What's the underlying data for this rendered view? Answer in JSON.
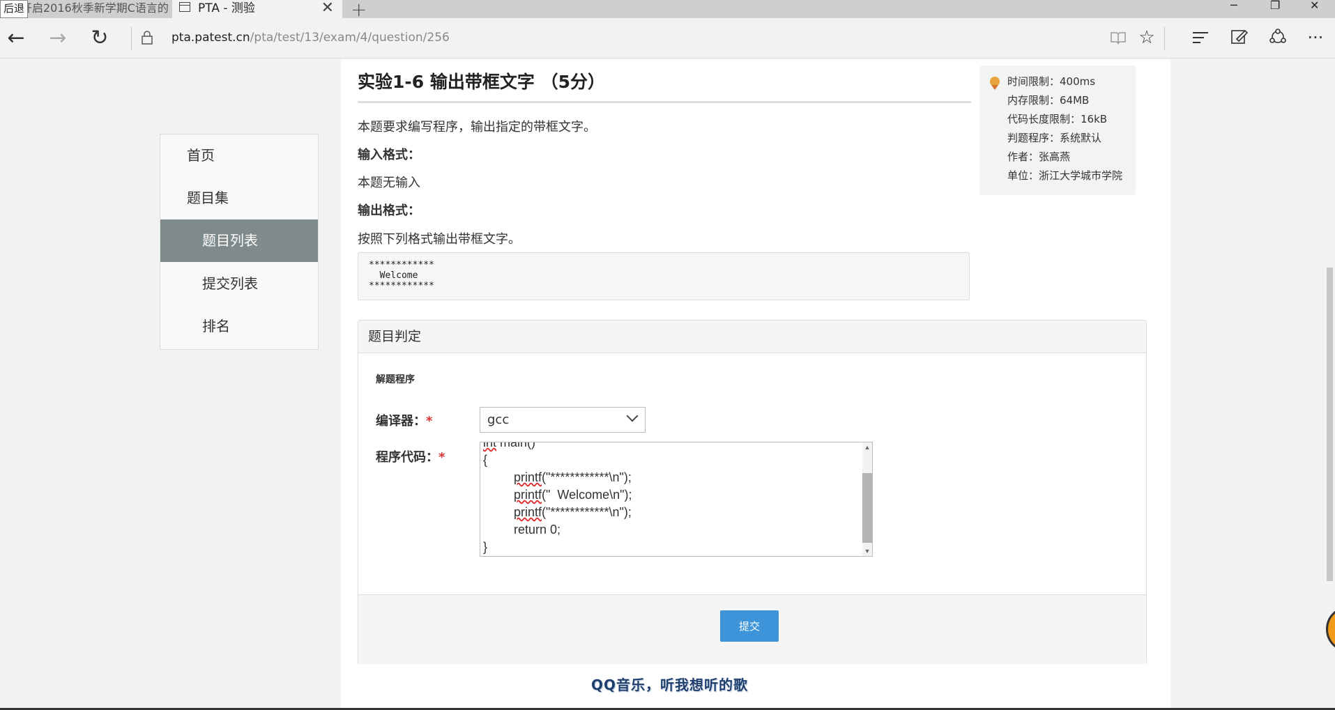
{
  "browser": {
    "back_tooltip": "后退",
    "inactive_tab_title": "开启2016秋季新学期C语言的",
    "active_tab_title": "PTA - 测验",
    "url_host": "pta.patest.cn",
    "url_path": "/pta/test/13/exam/4/question/256"
  },
  "sidebar": {
    "items": [
      {
        "label": "首页"
      },
      {
        "label": "题目集"
      },
      {
        "label": "题目列表"
      },
      {
        "label": "提交列表"
      },
      {
        "label": "排名"
      }
    ],
    "active_index": 2
  },
  "problem": {
    "title": "实验1-6 输出带框文字 （5分）",
    "description": "本题要求编写程序，输出指定的带框文字。",
    "input_heading": "输入格式：",
    "input_text": "本题无输入",
    "output_heading": "输出格式：",
    "output_text": "按照下列格式输出带框文字。",
    "sample_output": "************\n  Welcome\n************"
  },
  "info": {
    "time_limit": "时间限制：400ms",
    "memory_limit": "内存限制：64MB",
    "code_limit": "代码长度限制：16kB",
    "judge": "判题程序：系统默认",
    "author": "作者：张高燕",
    "unit": "单位：浙江大学城市学院"
  },
  "judge_panel": {
    "heading": "题目判定",
    "section_label": "解题程序",
    "compiler_label": "编译器：",
    "compiler_value": "gcc",
    "code_label": "程序代码：",
    "required_mark": "*",
    "code_lines": [
      "int main()",
      "{",
      "\tprintf(\"************\\n\");",
      "\tprintf(\"  Welcome\\n\");",
      "\tprintf(\"************\\n\");",
      "\treturn 0;",
      "}"
    ],
    "submit_label": "提交"
  },
  "overlay": {
    "lyric_text": "QQ音乐，听我想听的歌"
  },
  "colors": {
    "accent": "#3d94d8",
    "sidebar_active": "#7f8b8b",
    "required": "#d33333"
  }
}
